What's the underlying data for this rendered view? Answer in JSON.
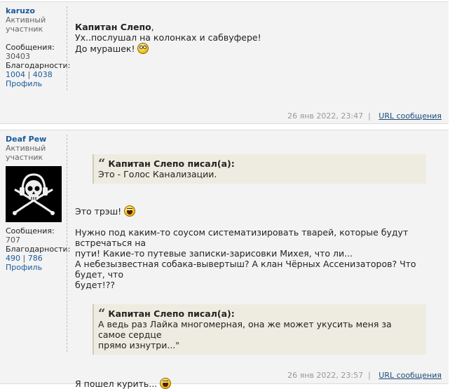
{
  "posts": [
    {
      "user": {
        "name": "karuzo",
        "rank": "Активный участник",
        "messages_label": "Сообщения:",
        "messages_value": "30403",
        "thanks_label": "Благодарности:",
        "thanks_given": "1004",
        "thanks_sep": "|",
        "thanks_received": "4038",
        "profile_label": "Профиль"
      },
      "body": {
        "addressee": "Капитан Слепо",
        "addressee_suffix": ",",
        "line1": "Ух..послушал на колонках и сабвуфере!",
        "line2": "До мурашек!",
        "smiley": "rolling-eyes-smiley-icon"
      },
      "footer": {
        "timestamp": "26 янв 2022, 23:47",
        "url_label": "URL сообщения"
      }
    },
    {
      "user": {
        "name": "Deaf Pew",
        "rank": "Активный участник",
        "avatar": "skull-headphones-crossed-swords",
        "messages_label": "Сообщения:",
        "messages_value": "707",
        "thanks_label": "Благодарности:",
        "thanks_given": "490",
        "thanks_sep": "|",
        "thanks_received": "786",
        "profile_label": "Профиль"
      },
      "quote1": {
        "author": "Капитан Слепо писал(а):",
        "text": "Это - Голос Канализации."
      },
      "text1": "Это трэш!",
      "text2_l1": "Нужно под каким-то соусом систематизировать тварей, которые будут встречаться на",
      "text2_l2": "пути! Какие-то путевые записки-зарисовки Михея, что ли...",
      "text2_l3": "А небезызвестная собака-вывертыш? А клан Чёрных Ассенизаторов? Что будет, что",
      "text2_l4": "будет!??",
      "quote2": {
        "author": "Капитан Слепо писал(а):",
        "text_l1": "А ведь раз Лайка многомерная, она же может укусить меня за самое сердце",
        "text_l2": "прямо изнутри...\""
      },
      "text3": "Я пошел курить...",
      "footer": {
        "timestamp": "26 янв 2022, 23:57",
        "url_label": "URL сообщения"
      }
    }
  ]
}
